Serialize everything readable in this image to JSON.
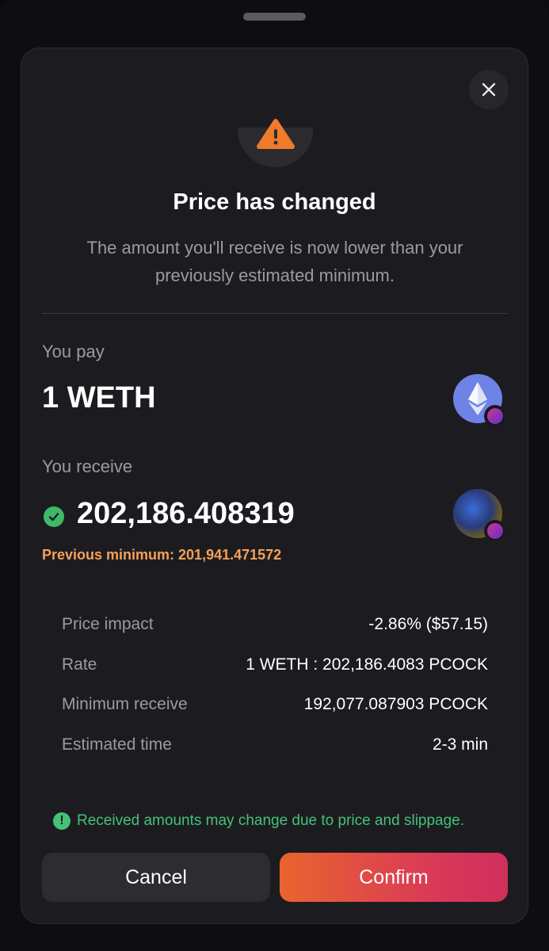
{
  "modal": {
    "title": "Price has changed",
    "subtitle": "The amount you'll receive is now lower than your previously estimated minimum."
  },
  "pay": {
    "label": "You pay",
    "amount": "1 WETH",
    "token_icon": "ethereum-icon"
  },
  "receive": {
    "label": "You receive",
    "amount": "202,186.408319",
    "token_icon": "pcock-token-icon",
    "previous_minimum": "Previous minimum: 201,941.471572"
  },
  "details": [
    {
      "key": "Price impact",
      "value": "-2.86% ($57.15)"
    },
    {
      "key": "Rate",
      "value": "1 WETH : 202,186.4083 PCOCK"
    },
    {
      "key": "Minimum receive",
      "value": "192,077.087903 PCOCK"
    },
    {
      "key": "Estimated time",
      "value": "2-3 min"
    }
  ],
  "note": "Received amounts may change due to price and slippage.",
  "buttons": {
    "cancel": "Cancel",
    "confirm": "Confirm"
  },
  "colors": {
    "background": "#1c1c20",
    "warning": "#f07a2c",
    "success": "#44c276",
    "previous_min": "#f5a05a",
    "confirm_gradient_start": "#e9642f",
    "confirm_gradient_end": "#cf2f5c"
  }
}
